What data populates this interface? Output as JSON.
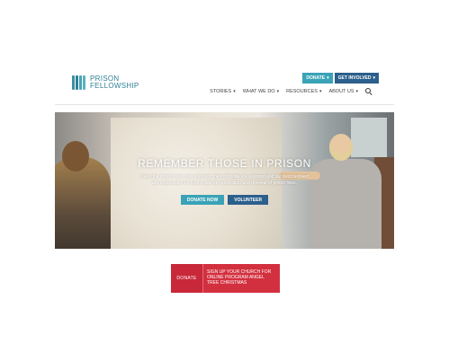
{
  "header": {
    "logo": {
      "line1": "PRISON",
      "line2": "FELLOWSHIP"
    },
    "buttons": {
      "donate": "DONATE",
      "involved": "GET INVOLVED"
    },
    "nav": [
      {
        "label": "STORIES"
      },
      {
        "label": "WHAT WE DO"
      },
      {
        "label": "RESOURCES"
      },
      {
        "label": "ABOUT US"
      }
    ]
  },
  "hero": {
    "title": "REMEMBER THOSE IN PRISON",
    "subtitle_line1": "Deep the most broken are restored, men of inside are restored and our best beloved",
    "subtitle_line2": "are responsible for God's plan for restoration and renewal of prison lives.",
    "donate_button": "DONATE NOW",
    "volunteer_button": "VOLUNTEER"
  },
  "promo": {
    "left_label": "DONATE",
    "text": "SIGN UP YOUR CHURCH FOR ONLINE PROGRAM ANGEL TREE CHRISTMAS"
  },
  "colors": {
    "brand_teal": "#3aa3b7",
    "brand_navy": "#2b5f8c",
    "promo_red": "#d3303f"
  },
  "icons": [
    "logo-mark-icon",
    "chevron-down-icon",
    "search-icon"
  ]
}
